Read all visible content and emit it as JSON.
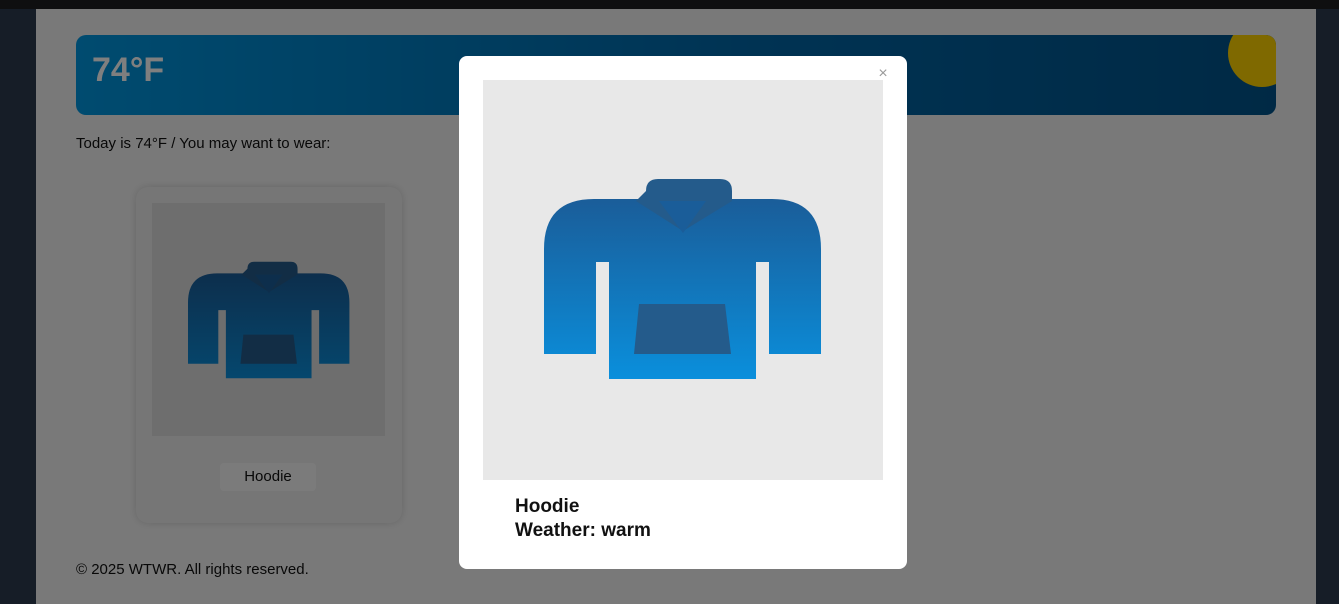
{
  "header": {
    "temperature": "74°F"
  },
  "main": {
    "intro_text": "Today is 74°F / You may want to wear:",
    "items": [
      {
        "name": "Hoodie",
        "icon": "hoodie-icon"
      }
    ]
  },
  "footer": {
    "copyright": "© 2025 WTWR. All rights reserved."
  },
  "modal": {
    "close_label": "×",
    "title": "Hoodie",
    "weather": "Weather: warm",
    "icon": "hoodie-icon"
  },
  "colors": {
    "banner_start": "#0097e0",
    "banner_end": "#00538a",
    "sun": "#ffd200",
    "hoodie_top": "#1a5d99",
    "hoodie_bottom": "#0a8fdc",
    "pocket": "#245b8b"
  }
}
